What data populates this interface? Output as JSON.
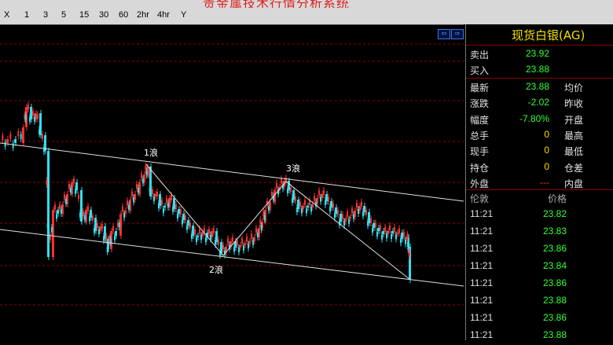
{
  "window": {
    "title": "贵金属技术行情分析系统"
  },
  "timeframes": [
    "X",
    "1",
    "3",
    "5",
    "15",
    "30",
    "60",
    "2hr",
    "4hr",
    "Y"
  ],
  "chart": {
    "wave_labels": {
      "w1": "1浪",
      "w2": "2浪",
      "w3": "3浪"
    },
    "colors": {
      "up": "#ff3030",
      "down": "#30e0f0",
      "grid": "#8a0000",
      "trend": "#e0e0e0"
    }
  },
  "panel": {
    "symbol": "现货白银(AG)",
    "quote": {
      "sell_label": "卖出",
      "sell": "23.92",
      "buy_label": "买入",
      "buy": "23.88"
    },
    "stats": [
      {
        "label": "最新",
        "value": "23.88",
        "label2": "均价",
        "color": "#33ff33"
      },
      {
        "label": "涨跌",
        "value": "-2.02",
        "label2": "昨收",
        "color": "#33ff33"
      },
      {
        "label": "幅度",
        "value": "-7.80%",
        "label2": "开盘",
        "color": "#33ff33"
      },
      {
        "label": "总手",
        "value": "0",
        "label2": "最高",
        "color": "#f0e000"
      },
      {
        "label": "现手",
        "value": "0",
        "label2": "最低",
        "color": "#f0e000"
      },
      {
        "label": "持仓",
        "value": "0",
        "label2": "仓差",
        "color": "#f0e000"
      },
      {
        "label": "外盘",
        "value": "---",
        "label2": "内盘",
        "color": "#ff3030"
      }
    ],
    "ticks_header": {
      "time": "伦敦",
      "price": "价格"
    },
    "ticks": [
      {
        "time": "11:21",
        "price": "23.82"
      },
      {
        "time": "11:21",
        "price": "23.83"
      },
      {
        "time": "11:21",
        "price": "23.86"
      },
      {
        "time": "11:21",
        "price": "23.84"
      },
      {
        "time": "11:21",
        "price": "23.86"
      },
      {
        "time": "11:21",
        "price": "23.88"
      },
      {
        "time": "11:21",
        "price": "23.86"
      },
      {
        "time": "11:21",
        "price": "23.88"
      }
    ]
  }
}
